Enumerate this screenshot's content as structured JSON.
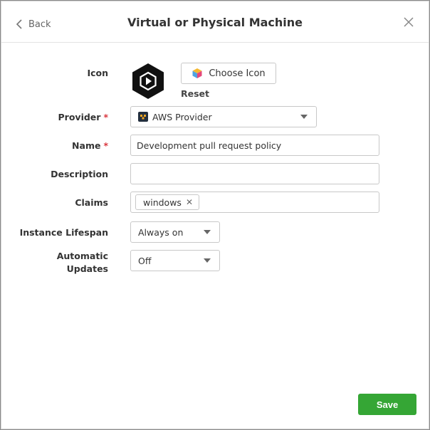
{
  "header": {
    "back_label": "Back",
    "title": "Virtual or Physical Machine"
  },
  "form": {
    "icon_label": "Icon",
    "choose_icon_label": "Choose Icon",
    "reset_label": "Reset",
    "provider_label": "Provider",
    "provider_value": "AWS Provider",
    "name_label": "Name",
    "name_value": "Development pull request policy",
    "description_label": "Description",
    "description_value": "",
    "claims_label": "Claims",
    "claims": [
      "windows"
    ],
    "lifespan_label": "Instance Lifespan",
    "lifespan_value": "Always on",
    "updates_label_line1": "Automatic",
    "updates_label_line2": "Updates",
    "updates_value": "Off",
    "required_mark": "*"
  },
  "footer": {
    "save_label": "Save"
  },
  "colors": {
    "save_button": "#35a635",
    "required": "#d9363e",
    "icon_bg": "#111111"
  },
  "icons": [
    "chevron-left-icon",
    "close-icon",
    "play-hexagon-icon",
    "color-cube-icon",
    "aws-logo-icon",
    "caret-down-icon",
    "remove-x-icon"
  ]
}
